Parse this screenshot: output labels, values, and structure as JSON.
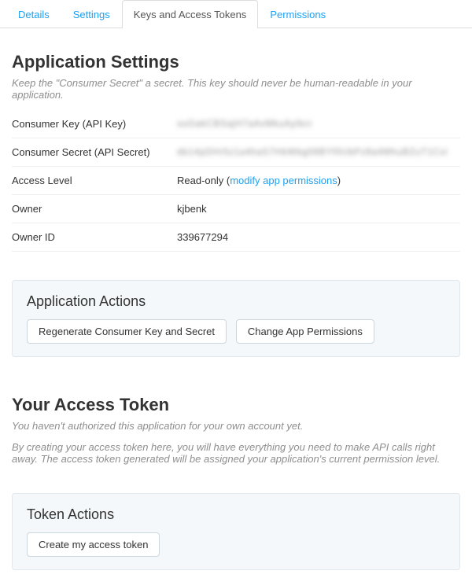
{
  "tabs": {
    "details": "Details",
    "settings": "Settings",
    "keys": "Keys and Access Tokens",
    "permissions": "Permissions"
  },
  "appSettings": {
    "heading": "Application Settings",
    "hint": "Keep the \"Consumer Secret\" a secret. This key should never be human-readable in your application.",
    "rows": {
      "consumerKey": {
        "label": "Consumer Key (API Key)",
        "value": "suGakCBSajH7aAvMkuAyIkcr"
      },
      "consumerSecret": {
        "label": "Consumer Secret (API Secret)",
        "value": "db14pDHr5z1a4haS7HbWbg08BYf0UbPz8a4MhuBZuT1Cvi"
      },
      "accessLevel": {
        "label": "Access Level",
        "prefix": "Read-only (",
        "link": "modify app permissions",
        "suffix": ")"
      },
      "owner": {
        "label": "Owner",
        "value": "kjbenk"
      },
      "ownerId": {
        "label": "Owner ID",
        "value": "339677294"
      }
    }
  },
  "appActions": {
    "heading": "Application Actions",
    "regenerate": "Regenerate Consumer Key and Secret",
    "changePerms": "Change App Permissions"
  },
  "accessToken": {
    "heading": "Your Access Token",
    "hint1": "You haven't authorized this application for your own account yet.",
    "hint2": "By creating your access token here, you will have everything you need to make API calls right away. The access token generated will be assigned your application's current permission level."
  },
  "tokenActions": {
    "heading": "Token Actions",
    "create": "Create my access token"
  }
}
